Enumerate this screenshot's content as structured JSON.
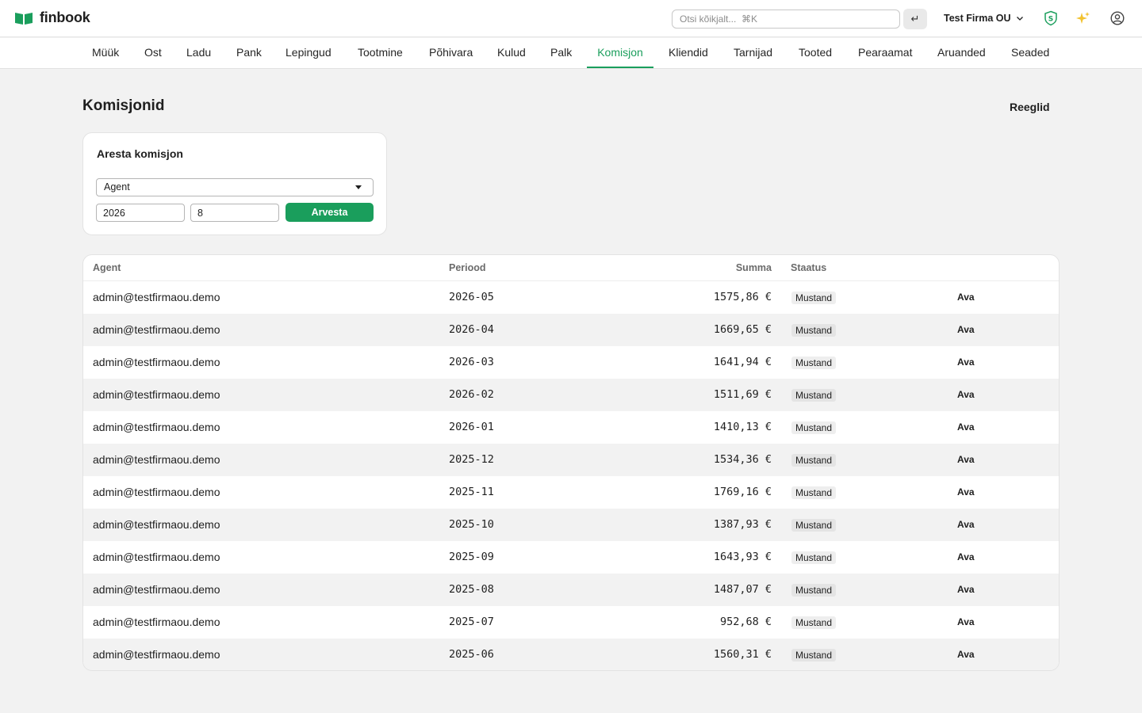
{
  "app": {
    "name": "finbook",
    "search_placeholder": "Otsi kõikjalt...  ⌘K",
    "enter_symbol": "↵",
    "company": "Test Firma OU"
  },
  "nav": {
    "items": [
      "Müük",
      "Ost",
      "Ladu",
      "Pank",
      "Lepingud",
      "Tootmine",
      "Põhivara",
      "Kulud",
      "Palk",
      "Komisjon",
      "Kliendid",
      "Tarnijad",
      "Tooted",
      "Pearaamat",
      "Aruanded",
      "Seaded"
    ],
    "active": "Komisjon"
  },
  "page": {
    "title": "Komisjonid",
    "rules_link": "Reeglid"
  },
  "form": {
    "title": "Aresta komisjon",
    "agent_select": "Agent",
    "year": "2026",
    "month": "8",
    "submit": "Arvesta"
  },
  "table": {
    "headers": {
      "agent": "Agent",
      "period": "Periood",
      "sum": "Summa",
      "status": "Staatus"
    },
    "open_label": "Ava",
    "rows": [
      {
        "agent": "admin@testfirmaou.demo",
        "period": "2026-05",
        "sum": "1575,86 €",
        "status": "Mustand"
      },
      {
        "agent": "admin@testfirmaou.demo",
        "period": "2026-04",
        "sum": "1669,65 €",
        "status": "Mustand"
      },
      {
        "agent": "admin@testfirmaou.demo",
        "period": "2026-03",
        "sum": "1641,94 €",
        "status": "Mustand"
      },
      {
        "agent": "admin@testfirmaou.demo",
        "period": "2026-02",
        "sum": "1511,69 €",
        "status": "Mustand"
      },
      {
        "agent": "admin@testfirmaou.demo",
        "period": "2026-01",
        "sum": "1410,13 €",
        "status": "Mustand"
      },
      {
        "agent": "admin@testfirmaou.demo",
        "period": "2025-12",
        "sum": "1534,36 €",
        "status": "Mustand"
      },
      {
        "agent": "admin@testfirmaou.demo",
        "period": "2025-11",
        "sum": "1769,16 €",
        "status": "Mustand"
      },
      {
        "agent": "admin@testfirmaou.demo",
        "period": "2025-10",
        "sum": "1387,93 €",
        "status": "Mustand"
      },
      {
        "agent": "admin@testfirmaou.demo",
        "period": "2025-09",
        "sum": "1643,93 €",
        "status": "Mustand"
      },
      {
        "agent": "admin@testfirmaou.demo",
        "period": "2025-08",
        "sum": "1487,07 €",
        "status": "Mustand"
      },
      {
        "agent": "admin@testfirmaou.demo",
        "period": "2025-07",
        "sum": "952,68 €",
        "status": "Mustand"
      },
      {
        "agent": "admin@testfirmaou.demo",
        "period": "2025-06",
        "sum": "1560,31 €",
        "status": "Mustand"
      }
    ]
  },
  "icons": {
    "logo": "book-icon",
    "shield": "shield-icon",
    "sparkle": "sparkle-icon",
    "user": "user-circle-icon",
    "company_chevron": "chevron-down-icon",
    "select_caret": "caret-down-icon"
  },
  "colors": {
    "accent": "#1a9e5c",
    "background": "#f2f2f2",
    "sparkle": "#f2c230"
  }
}
